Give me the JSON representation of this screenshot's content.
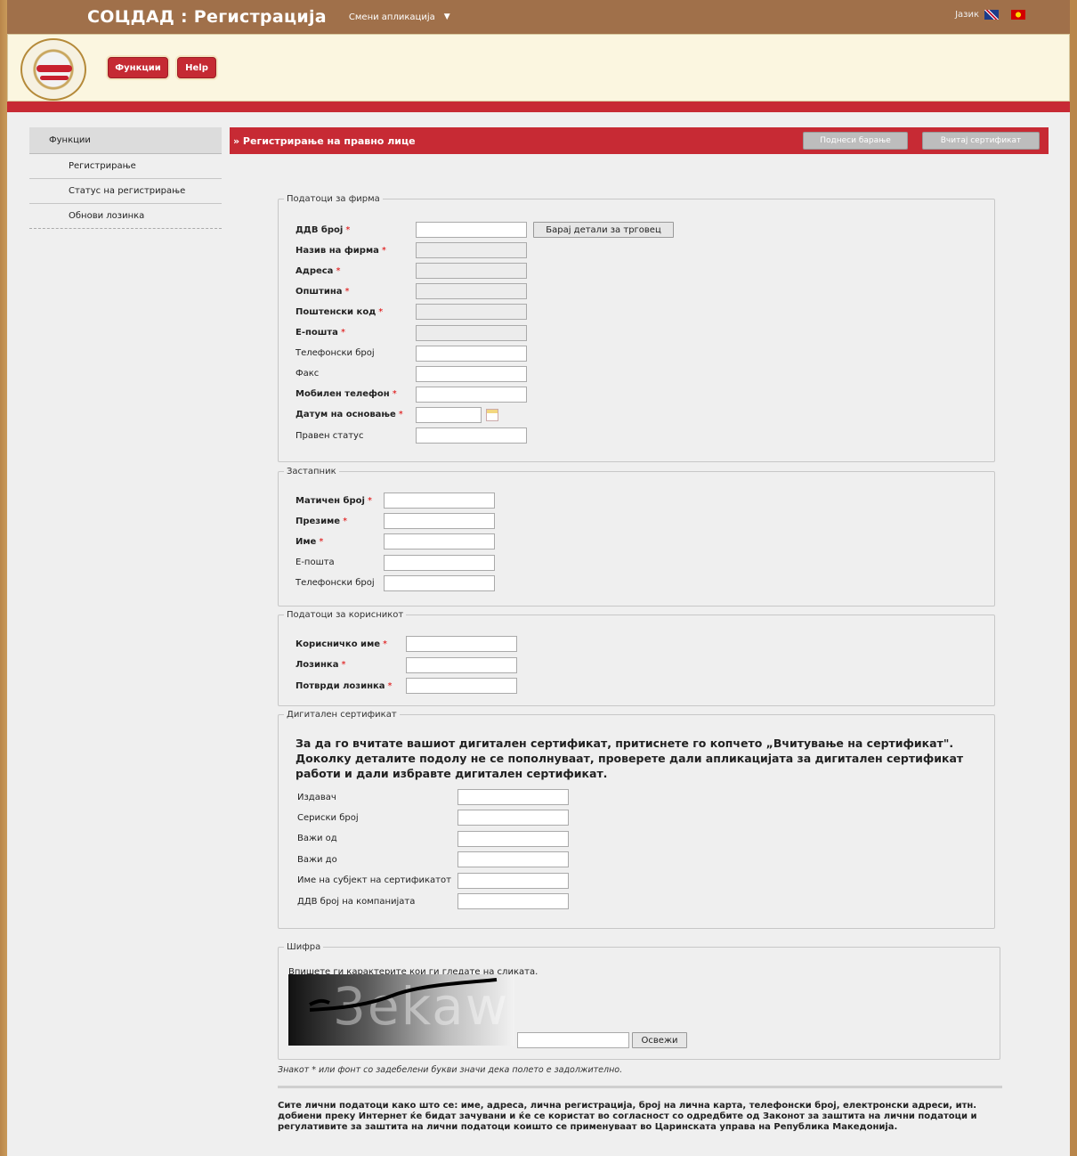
{
  "app": {
    "title": "СОЦДАД : Регистрација",
    "switch_app": "Смени апликација",
    "language_label": "Јазик"
  },
  "header": {
    "functions_button": "Функции",
    "help_button": "Help"
  },
  "sidebar": {
    "heading": "Функции",
    "items": [
      {
        "label": "Регистрирање"
      },
      {
        "label": "Статус на регистрирање"
      },
      {
        "label": "Обнови лозинка"
      }
    ]
  },
  "main": {
    "title": "» Регистрирање на правно лице",
    "submit_button": "Поднеси барање",
    "load_cert_button": "Вчитај сертификат"
  },
  "company": {
    "legend": "Податоци за фирма",
    "search_button": "Барај детали за трговец",
    "fields": [
      {
        "label": "ДДВ број",
        "required": "*"
      },
      {
        "label": "Назив на фирма",
        "required": "*"
      },
      {
        "label": "Адреса",
        "required": "*"
      },
      {
        "label": "Општина",
        "required": "*"
      },
      {
        "label": "Поштенски код",
        "required": "*"
      },
      {
        "label": "Е-пошта",
        "required": "*"
      },
      {
        "label": "Телефонски број",
        "required": ""
      },
      {
        "label": "Факс",
        "required": ""
      },
      {
        "label": "Мобилен телефон",
        "required": "*"
      },
      {
        "label": "Датум на основање",
        "required": "*"
      },
      {
        "label": "Правен статус",
        "required": ""
      }
    ]
  },
  "representative": {
    "legend": "Застапник",
    "fields": [
      {
        "label": "Матичен број",
        "required": "*"
      },
      {
        "label": "Презиме",
        "required": "*"
      },
      {
        "label": "Име",
        "required": "*"
      },
      {
        "label": "Е-пошта",
        "required": ""
      },
      {
        "label": "Телефонски број",
        "required": ""
      }
    ]
  },
  "user": {
    "legend": "Податоци за корисникот",
    "fields": [
      {
        "label": "Корисничко име",
        "required": "*"
      },
      {
        "label": "Лозинка",
        "required": "*"
      },
      {
        "label": "Потврди лозинка",
        "required": "*"
      }
    ]
  },
  "certificate": {
    "legend": "Дигитален сертификат",
    "note": "За да го вчитате вашиот дигитален сертификат, притиснете го копчето „Вчитување на сертификат\". Доколку деталите подолу не се пополнуваат, проверете дали апликацијата за дигитален сертификат работи и дали избравте дигитален сертификат.",
    "fields": [
      {
        "label": "Издавач"
      },
      {
        "label": "Сериски број"
      },
      {
        "label": "Важи од"
      },
      {
        "label": "Важи до"
      },
      {
        "label": "Име на субјект на сертификатот"
      },
      {
        "label": "ДДВ број на компанијата"
      }
    ]
  },
  "captcha": {
    "legend": "Шифра",
    "instruction": "Впишете ги карактерите кои ги гледате на сликата.",
    "image_text": "3ekaw",
    "refresh_button": "Освежи"
  },
  "footer": {
    "required_note": "Знакот * или фонт со задебелени букви значи дека полето е задолжително.",
    "privacy": "Сите лични податоци како што се: име, адреса, лична регистрација, број на лична карта, телефонски број, електронски адреси, итн. добиени преку Интернет ќе бидат зачувани и ќе се користат во согласност со одредбите од Законот за заштита на лични податоци и регулативите за заштита на лични податоци коишто се применуваат во Царинската управа на Република Македонија."
  },
  "colors": {
    "accent_red": "#c72a34",
    "topbar_brown": "#a0704a",
    "header_cream": "#fbf6e0"
  }
}
